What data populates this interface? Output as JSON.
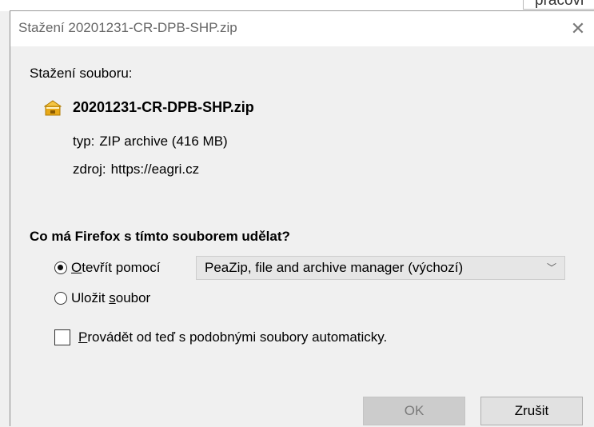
{
  "background": {
    "partial_text": "pracovi"
  },
  "dialog": {
    "title": "Stažení 20201231-CR-DPB-SHP.zip",
    "close_glyph": "✕",
    "heading": "Stažení souboru:",
    "file": {
      "icon": "zip-archive-icon",
      "name": "20201231-CR-DPB-SHP.zip",
      "type_label": "typ:",
      "type_value": "ZIP archive (416 MB)",
      "source_label": "zdroj:",
      "source_value": "https://eagri.cz"
    },
    "question": "Co má Firefox s tímto souborem udělat?",
    "options": {
      "open_with": {
        "mnemonic": "O",
        "rest": "tevřít pomocí",
        "checked": true
      },
      "save_file": {
        "before": "Uložit ",
        "mnemonic": "s",
        "rest": "oubor",
        "checked": false
      }
    },
    "app_select": {
      "value": "PeaZip, file and archive manager (výchozí)",
      "chevron": "﹀"
    },
    "auto_checkbox": {
      "mnemonic": "P",
      "rest": "rovádět od teď s podobnými soubory automaticky.",
      "checked": false
    },
    "buttons": {
      "ok": "OK",
      "cancel": "Zrušit"
    }
  },
  "colors": {
    "title_text": "#666666",
    "dialog_bg": "#f0f0f0",
    "ok_disabled_bg": "#cccccc",
    "cancel_bg": "#e1e1e1"
  }
}
